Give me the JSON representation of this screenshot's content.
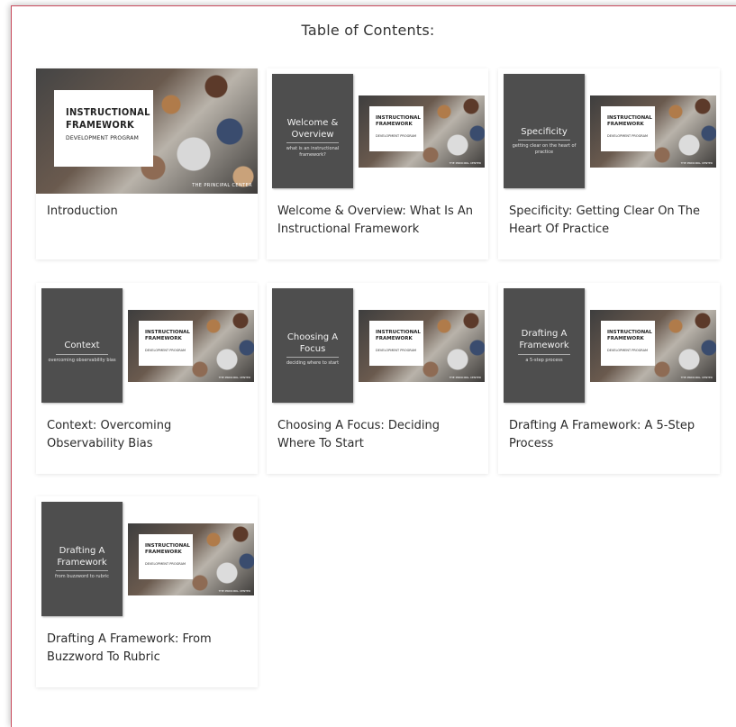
{
  "heading": "Table of Contents:",
  "intro_image": {
    "line1": "INSTRUCTIONAL",
    "line2": "FRAMEWORK",
    "line3": "DEVELOPMENT PROGRAM",
    "credit": "THE PRINCIPAL CENTER"
  },
  "slide_photo": {
    "line1": "INSTRUCTIONAL",
    "line2": "FRAMEWORK",
    "line3": "DEVELOPMENT PROGRAM",
    "credit": "THE PRINCIPAL CENTER"
  },
  "lessons": [
    {
      "title": "Introduction"
    },
    {
      "title": "Welcome & Overview: What Is An Instructional Framework",
      "slide_main": "Welcome & Overview",
      "slide_sub": "what is an instructional framework?"
    },
    {
      "title": "Specificity: Getting Clear On The Heart Of Practice",
      "slide_main": "Specificity",
      "slide_sub": "getting clear on the heart of practice"
    },
    {
      "title": "Context: Overcoming Observability Bias",
      "slide_main": "Context",
      "slide_sub": "overcoming observability bias"
    },
    {
      "title": "Choosing A Focus: Deciding Where To Start",
      "slide_main": "Choosing A Focus",
      "slide_sub": "deciding where to start"
    },
    {
      "title": "Drafting A Framework: A 5-Step Process",
      "slide_main": "Drafting A Framework",
      "slide_sub": "a 5-step process"
    },
    {
      "title": "Drafting A Framework: From Buzzword To Rubric",
      "slide_main": "Drafting A Framework",
      "slide_sub": "from buzzword to rubric"
    }
  ]
}
